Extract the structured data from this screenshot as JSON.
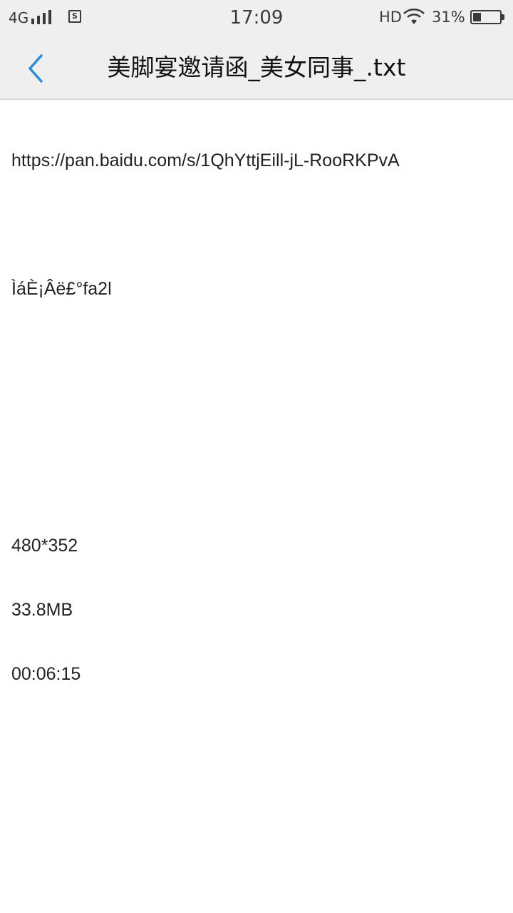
{
  "status_bar": {
    "network": "4G",
    "time": "17:09",
    "hd": "HD",
    "battery_text": "31%",
    "battery_level": 0.31,
    "sim_icon": "S"
  },
  "header": {
    "back_icon": "chevron-left-icon",
    "title": "美脚宴邀请函_美女同事_.txt"
  },
  "file": {
    "lines": [
      "https://pan.baidu.com/s/1QhYttjEill-jL-RooRKPvA",
      "",
      "ÌáÈ¡Âë£°fa2l",
      "",
      "",
      "",
      "480*352",
      "33.8MB",
      "00:06:15"
    ]
  },
  "colors": {
    "accent": "#2a8de0",
    "toolbar_bg": "#efefef",
    "text": "#222222"
  }
}
